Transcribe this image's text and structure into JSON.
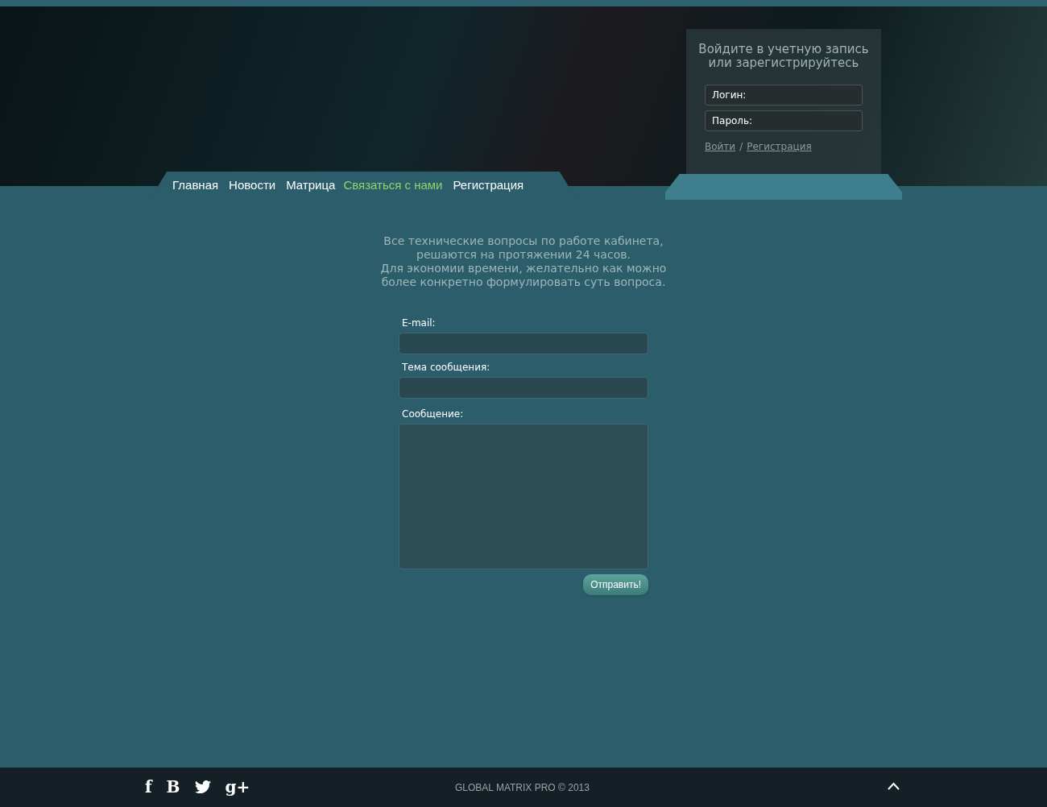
{
  "login": {
    "title": "Войдите в учетную запись или зарегистрируйтесь",
    "fields": [
      {
        "placeholder": "Логин:"
      },
      {
        "placeholder": "Пароль:"
      }
    ],
    "links": [
      "Войти",
      "Регистрация"
    ],
    "separator": "/"
  },
  "nav": [
    {
      "label": "Главная",
      "selected": false
    },
    {
      "label": "Новости",
      "selected": false
    },
    {
      "label": "Матрица",
      "selected": false
    },
    {
      "label": "Связаться с нами",
      "selected": true
    },
    {
      "label": "Регистрация",
      "selected": false
    }
  ],
  "intro": [
    "Все технические вопросы по работе кабинета,",
    "решаются на протяжении 24 часов.",
    "Для экономии времени, желательно как можно",
    "более конкретно формулировать суть вопроса."
  ],
  "form": {
    "fields": [
      {
        "kind": "input",
        "label": "E-mail:"
      },
      {
        "kind": "input",
        "label": "Тема сообщения:"
      },
      {
        "kind": "textarea",
        "label": "Сообщение:"
      }
    ],
    "submit": "Отправить!"
  },
  "footer": {
    "social": [
      {
        "kind": "glyph",
        "label": "f"
      },
      {
        "kind": "glyph",
        "label": "B"
      },
      {
        "kind": "bird"
      },
      {
        "kind": "glyph",
        "label": "g+"
      }
    ],
    "copyright": "GLOBAL MATRIX PRO © 2013"
  }
}
